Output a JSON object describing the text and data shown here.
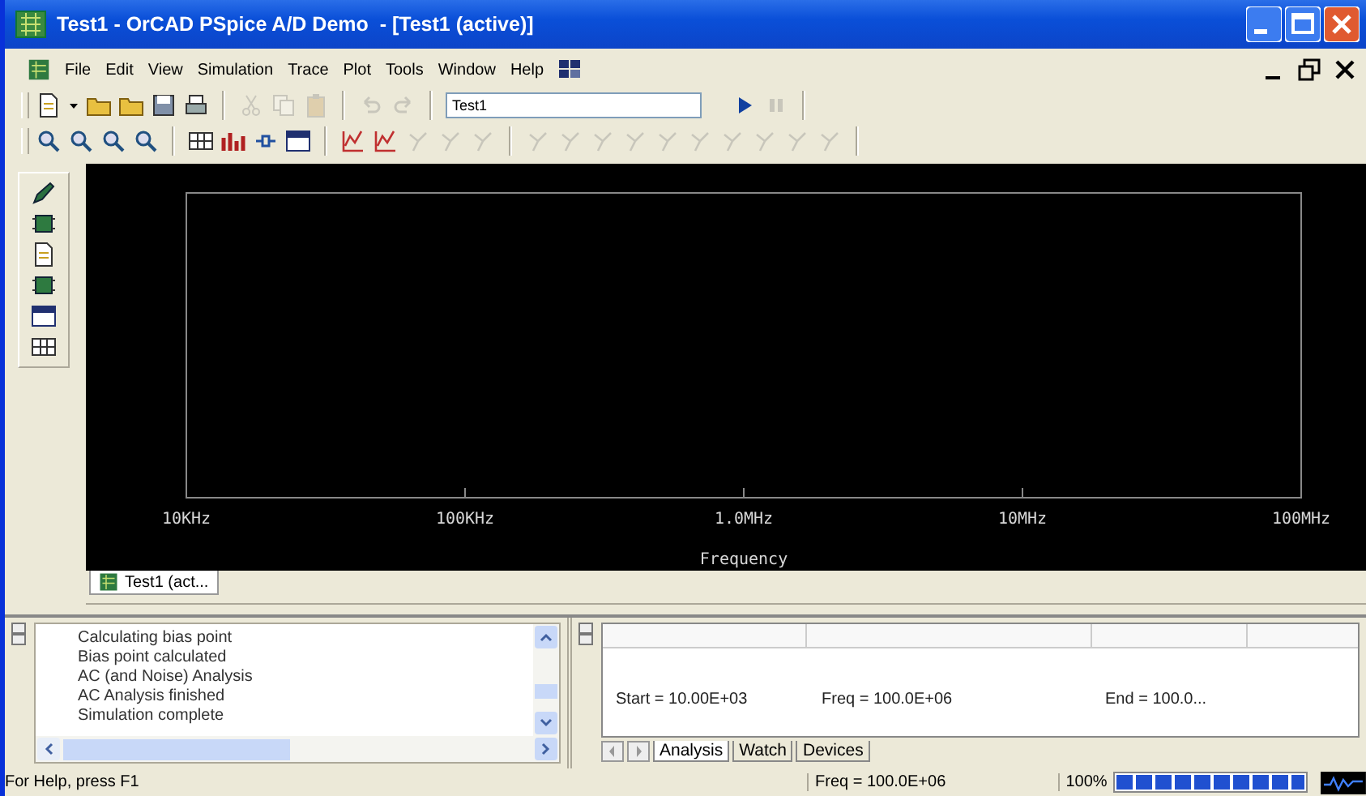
{
  "window": {
    "title": "Test1 - OrCAD PSpice A/D Demo  - [Test1 (active)]"
  },
  "menu": [
    "File",
    "Edit",
    "View",
    "Simulation",
    "Trace",
    "Plot",
    "Tools",
    "Window",
    "Help"
  ],
  "toolbar_1": {
    "groups": [
      [
        {
          "disabled": false
        },
        {
          "disabled": false
        },
        {
          "disabled": false
        },
        {
          "disabled": false
        },
        {
          "disabled": false
        }
      ],
      [
        {
          "disabled": true
        },
        {
          "disabled": true
        },
        {
          "disabled": true
        }
      ],
      [
        {
          "disabled": true
        },
        {
          "disabled": true
        }
      ]
    ],
    "profile_field": {
      "value": "Test1"
    },
    "run_buttons": [
      {
        "disabled": false
      },
      {
        "disabled": true
      }
    ]
  },
  "toolbar_2": {
    "groups": [
      [
        {
          "disabled": false
        },
        {
          "disabled": false
        },
        {
          "disabled": false
        },
        {
          "disabled": false
        }
      ],
      [
        {
          "disabled": false
        },
        {
          "disabled": false
        },
        {
          "disabled": false
        },
        {
          "disabled": false
        }
      ],
      [
        {
          "disabled": false
        },
        {
          "disabled": false
        },
        {
          "disabled": true
        },
        {
          "disabled": true
        },
        {
          "disabled": true
        }
      ],
      [
        {
          "disabled": true
        },
        {
          "disabled": true
        },
        {
          "disabled": true
        },
        {
          "disabled": true
        },
        {
          "disabled": true
        },
        {
          "disabled": true
        },
        {
          "disabled": true
        },
        {
          "disabled": true
        },
        {
          "disabled": true
        },
        {
          "disabled": true
        }
      ]
    ]
  },
  "plot": {
    "x_axis_labels": [
      "10KHz",
      "100KHz",
      "1.0MHz",
      "10MHz",
      "100MHz"
    ],
    "x_axis_title": "Frequency"
  },
  "document_tabs": [
    {
      "label": "Test1 (act...",
      "selected": true
    }
  ],
  "output_log": [
    "Calculating bias point",
    "Bias point calculated",
    "AC (and Noise) Analysis",
    "AC Analysis finished",
    "Simulation complete"
  ],
  "analysis_panel": {
    "readouts": [
      "Start = 10.00E+03",
      "Freq = 100.0E+06",
      "End = 100.0..."
    ],
    "tabs": [
      {
        "label": "Analysis",
        "selected": true
      },
      {
        "label": "Watch",
        "selected": false
      },
      {
        "label": "Devices",
        "selected": false
      }
    ]
  },
  "status_bar": {
    "help": "For Help, press F1",
    "frequency": "Freq = 100.0E+06",
    "progress": {
      "reading": "100%",
      "level": 1
    }
  }
}
